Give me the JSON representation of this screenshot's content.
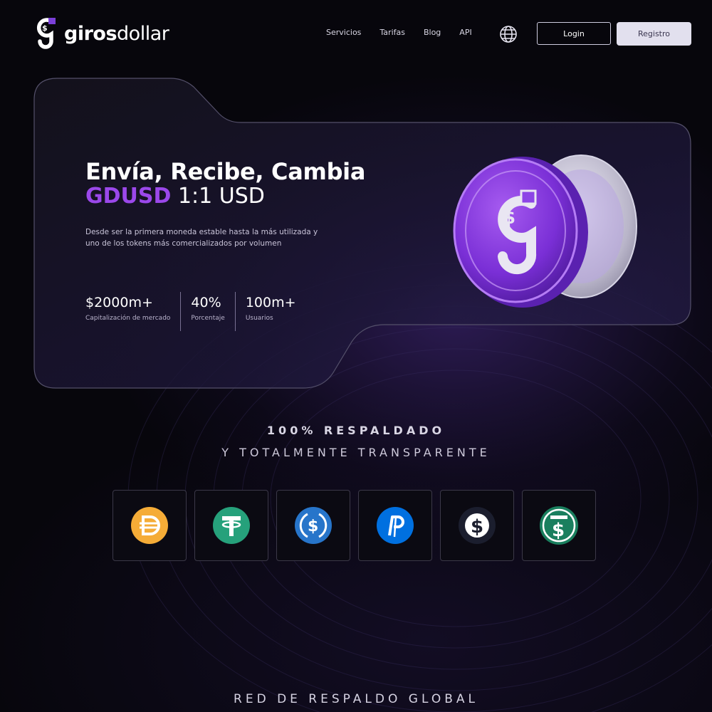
{
  "brand": {
    "name_bold": "giros",
    "name_light": "dollar",
    "logo_icon": "giros-g-logo-icon"
  },
  "nav": {
    "links": [
      "Servicios",
      "Tarifas",
      "Blog",
      "API"
    ],
    "globe_icon": "globe-icon",
    "login_label": "Login",
    "register_label": "Registro"
  },
  "hero": {
    "title": "Envía, Recibe, Cambia",
    "subtitle_accent": "GDUSD",
    "subtitle_rest": " 1:1 USD",
    "description": "Desde ser la primera moneda estable hasta la más utilizada y uno de los tokens más comercializados por volumen",
    "stats": [
      {
        "value": "$2000m+",
        "label": "Capitalización de mercado"
      },
      {
        "value": "40%",
        "label": "Porcentaje"
      },
      {
        "value": "100m+",
        "label": "Usuarios"
      }
    ],
    "coin_image": "gdusd-coin-illustration"
  },
  "backed": {
    "line1": "100% RESPALDADO",
    "line2": "Y TOTALMENTE TRANSPARENTE",
    "tokens": [
      {
        "icon": "dai-icon",
        "color": "#f5ac37"
      },
      {
        "icon": "tether-icon",
        "color": "#26a17b"
      },
      {
        "icon": "usdc-icon",
        "color": "#2775ca"
      },
      {
        "icon": "paypal-usd-icon",
        "color": "#0070e0"
      },
      {
        "icon": "dollar-coin-dark-icon",
        "color": "#1b1e2e"
      },
      {
        "icon": "stable-dollar-green-icon",
        "color": "#1a7f5e"
      }
    ]
  },
  "global_network": "RED DE RESPALDO GLOBAL",
  "colors": {
    "accent": "#9b48ea",
    "background": "#07060c"
  }
}
